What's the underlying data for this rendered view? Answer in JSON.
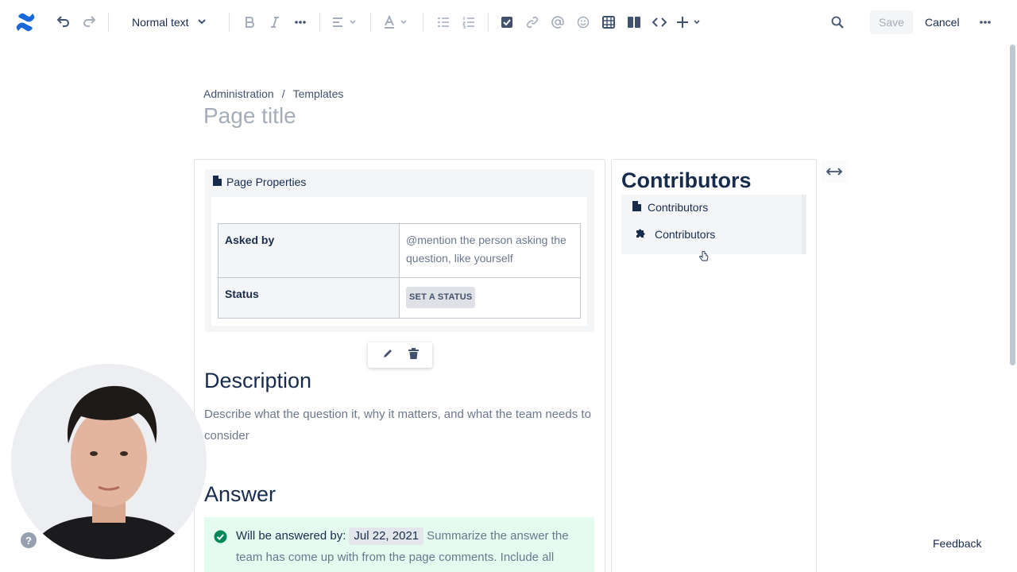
{
  "toolbar": {
    "text_style": "Normal text",
    "save_label": "Save",
    "cancel_label": "Cancel",
    "icons": [
      "confluence-logo",
      "undo",
      "redo",
      "bold",
      "italic",
      "more-formatting",
      "align",
      "text-color",
      "bullet-list",
      "numbered-list",
      "task",
      "link",
      "mention",
      "emoji",
      "table",
      "layouts",
      "code",
      "insert",
      "search",
      "more"
    ]
  },
  "breadcrumb": {
    "items": [
      "Administration",
      "Templates"
    ],
    "separator": "/"
  },
  "page": {
    "title_placeholder": "Page title"
  },
  "page_properties": {
    "macro_label": "Page Properties",
    "rows": [
      {
        "key": "Asked by",
        "value": "@mention the person asking the question, like yourself"
      },
      {
        "key": "Status",
        "value": "SET A STATUS"
      }
    ]
  },
  "description": {
    "heading": "Description",
    "text": "Describe what the question it, why it matters, and what the team needs to consider"
  },
  "answer": {
    "heading": "Answer",
    "label": "Will be answered by:",
    "date": "Jul 22, 2021",
    "text": "Summarize the answer the team has come up with from the page comments. Include all"
  },
  "right_column": {
    "heading": "Contributors",
    "macro_label": "Contributors",
    "plugin_label": "Contributors"
  },
  "help_label": "?",
  "feedback_label": "Feedback",
  "colors": {
    "brand": "#0052CC",
    "panel_success": "#E3FCEF",
    "success_icon": "#00875A"
  }
}
